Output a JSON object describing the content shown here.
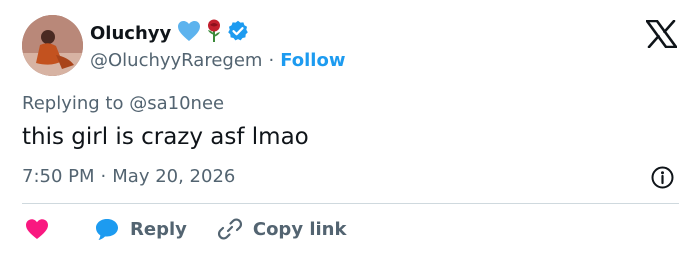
{
  "author": {
    "display_name": "Oluchyy",
    "handle": "@OluchyyRaregem",
    "separator": "·",
    "follow_label": "Follow",
    "emoji": [
      "blue-heart-icon",
      "rose-icon",
      "verified-badge-icon"
    ]
  },
  "reply_context": {
    "prefix": "Replying to",
    "mention": "@sa10nee"
  },
  "tweet": {
    "text": "this girl is crazy asf lmao",
    "time": "7:50 PM",
    "separator": "·",
    "date": "May 20, 2026"
  },
  "actions": {
    "reply_label": "Reply",
    "copy_link_label": "Copy link"
  },
  "colors": {
    "brand_blue": "#1d9bf0",
    "like_pink": "#f91880",
    "muted_text": "#536471",
    "divider": "#cfd9de",
    "text": "#0f1419"
  }
}
